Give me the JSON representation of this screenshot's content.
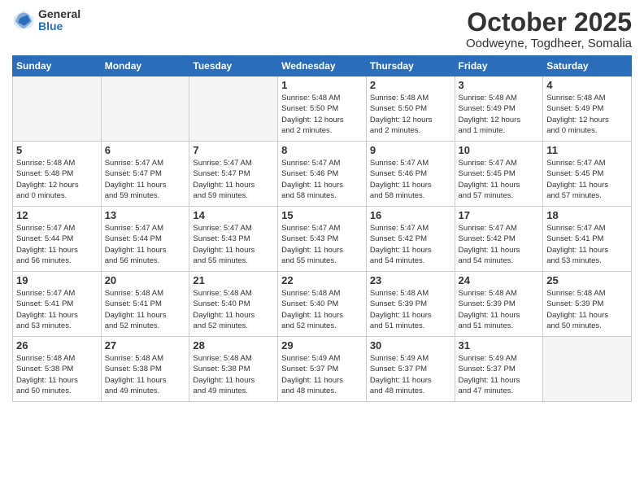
{
  "logo": {
    "general": "General",
    "blue": "Blue"
  },
  "title": "October 2025",
  "location": "Oodweyne, Togdheer, Somalia",
  "weekdays": [
    "Sunday",
    "Monday",
    "Tuesday",
    "Wednesday",
    "Thursday",
    "Friday",
    "Saturday"
  ],
  "weeks": [
    [
      {
        "day": "",
        "info": ""
      },
      {
        "day": "",
        "info": ""
      },
      {
        "day": "",
        "info": ""
      },
      {
        "day": "1",
        "info": "Sunrise: 5:48 AM\nSunset: 5:50 PM\nDaylight: 12 hours\nand 2 minutes."
      },
      {
        "day": "2",
        "info": "Sunrise: 5:48 AM\nSunset: 5:50 PM\nDaylight: 12 hours\nand 2 minutes."
      },
      {
        "day": "3",
        "info": "Sunrise: 5:48 AM\nSunset: 5:49 PM\nDaylight: 12 hours\nand 1 minute."
      },
      {
        "day": "4",
        "info": "Sunrise: 5:48 AM\nSunset: 5:49 PM\nDaylight: 12 hours\nand 0 minutes."
      }
    ],
    [
      {
        "day": "5",
        "info": "Sunrise: 5:48 AM\nSunset: 5:48 PM\nDaylight: 12 hours\nand 0 minutes."
      },
      {
        "day": "6",
        "info": "Sunrise: 5:47 AM\nSunset: 5:47 PM\nDaylight: 11 hours\nand 59 minutes."
      },
      {
        "day": "7",
        "info": "Sunrise: 5:47 AM\nSunset: 5:47 PM\nDaylight: 11 hours\nand 59 minutes."
      },
      {
        "day": "8",
        "info": "Sunrise: 5:47 AM\nSunset: 5:46 PM\nDaylight: 11 hours\nand 58 minutes."
      },
      {
        "day": "9",
        "info": "Sunrise: 5:47 AM\nSunset: 5:46 PM\nDaylight: 11 hours\nand 58 minutes."
      },
      {
        "day": "10",
        "info": "Sunrise: 5:47 AM\nSunset: 5:45 PM\nDaylight: 11 hours\nand 57 minutes."
      },
      {
        "day": "11",
        "info": "Sunrise: 5:47 AM\nSunset: 5:45 PM\nDaylight: 11 hours\nand 57 minutes."
      }
    ],
    [
      {
        "day": "12",
        "info": "Sunrise: 5:47 AM\nSunset: 5:44 PM\nDaylight: 11 hours\nand 56 minutes."
      },
      {
        "day": "13",
        "info": "Sunrise: 5:47 AM\nSunset: 5:44 PM\nDaylight: 11 hours\nand 56 minutes."
      },
      {
        "day": "14",
        "info": "Sunrise: 5:47 AM\nSunset: 5:43 PM\nDaylight: 11 hours\nand 55 minutes."
      },
      {
        "day": "15",
        "info": "Sunrise: 5:47 AM\nSunset: 5:43 PM\nDaylight: 11 hours\nand 55 minutes."
      },
      {
        "day": "16",
        "info": "Sunrise: 5:47 AM\nSunset: 5:42 PM\nDaylight: 11 hours\nand 54 minutes."
      },
      {
        "day": "17",
        "info": "Sunrise: 5:47 AM\nSunset: 5:42 PM\nDaylight: 11 hours\nand 54 minutes."
      },
      {
        "day": "18",
        "info": "Sunrise: 5:47 AM\nSunset: 5:41 PM\nDaylight: 11 hours\nand 53 minutes."
      }
    ],
    [
      {
        "day": "19",
        "info": "Sunrise: 5:47 AM\nSunset: 5:41 PM\nDaylight: 11 hours\nand 53 minutes."
      },
      {
        "day": "20",
        "info": "Sunrise: 5:48 AM\nSunset: 5:41 PM\nDaylight: 11 hours\nand 52 minutes."
      },
      {
        "day": "21",
        "info": "Sunrise: 5:48 AM\nSunset: 5:40 PM\nDaylight: 11 hours\nand 52 minutes."
      },
      {
        "day": "22",
        "info": "Sunrise: 5:48 AM\nSunset: 5:40 PM\nDaylight: 11 hours\nand 52 minutes."
      },
      {
        "day": "23",
        "info": "Sunrise: 5:48 AM\nSunset: 5:39 PM\nDaylight: 11 hours\nand 51 minutes."
      },
      {
        "day": "24",
        "info": "Sunrise: 5:48 AM\nSunset: 5:39 PM\nDaylight: 11 hours\nand 51 minutes."
      },
      {
        "day": "25",
        "info": "Sunrise: 5:48 AM\nSunset: 5:39 PM\nDaylight: 11 hours\nand 50 minutes."
      }
    ],
    [
      {
        "day": "26",
        "info": "Sunrise: 5:48 AM\nSunset: 5:38 PM\nDaylight: 11 hours\nand 50 minutes."
      },
      {
        "day": "27",
        "info": "Sunrise: 5:48 AM\nSunset: 5:38 PM\nDaylight: 11 hours\nand 49 minutes."
      },
      {
        "day": "28",
        "info": "Sunrise: 5:48 AM\nSunset: 5:38 PM\nDaylight: 11 hours\nand 49 minutes."
      },
      {
        "day": "29",
        "info": "Sunrise: 5:49 AM\nSunset: 5:37 PM\nDaylight: 11 hours\nand 48 minutes."
      },
      {
        "day": "30",
        "info": "Sunrise: 5:49 AM\nSunset: 5:37 PM\nDaylight: 11 hours\nand 48 minutes."
      },
      {
        "day": "31",
        "info": "Sunrise: 5:49 AM\nSunset: 5:37 PM\nDaylight: 11 hours\nand 47 minutes."
      },
      {
        "day": "",
        "info": ""
      }
    ]
  ]
}
